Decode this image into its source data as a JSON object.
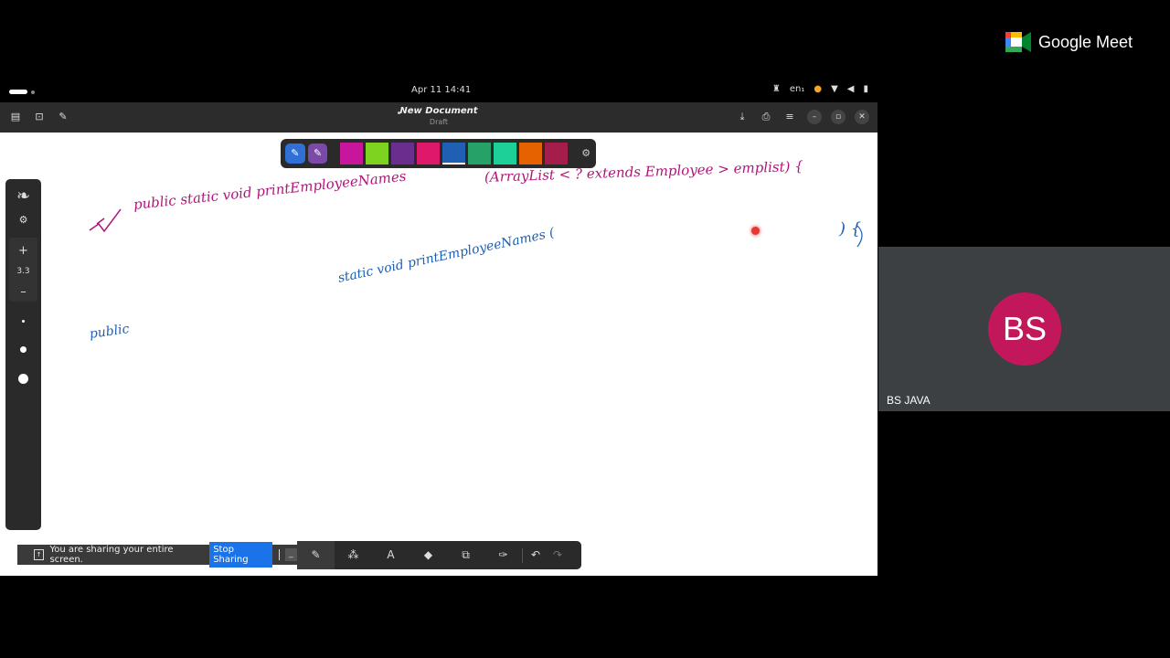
{
  "topbar": {
    "clock": "Apr 11  14:41",
    "lang": "en₁"
  },
  "document": {
    "title": "New Document",
    "subtitle": "Draft"
  },
  "left_toolbar": {
    "stroke_size": "3.3"
  },
  "whiteboard": {
    "line1": "public static void printEmployeeNames",
    "line1_args": "(ArrayList < ? extends Employee > emplist) {",
    "line2": "static void printEmployeeNames (",
    "line2_end": ") {",
    "line3": "public"
  },
  "share": {
    "message": "You are sharing your entire screen.",
    "stop_label": "Stop Sharing"
  },
  "meet": {
    "brand": "Google Meet",
    "initials": "BS",
    "participant": "BS JAVA"
  },
  "palette_colors": [
    "#c8169c",
    "#7ed321",
    "#6a2e8f",
    "#e0186c",
    "#1f5fb4",
    "#26a269",
    "#1bd197",
    "#e66100",
    "#a51d4a"
  ],
  "colors": {
    "avatar": "#c2185b",
    "stop_button": "#1a73e8"
  }
}
